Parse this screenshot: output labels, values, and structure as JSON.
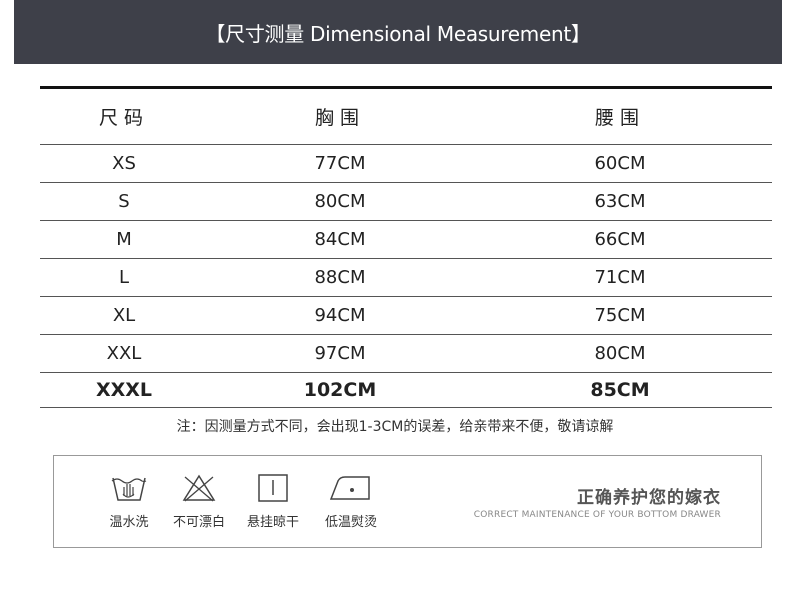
{
  "header": {
    "title": "【尺寸测量 Dimensional Measurement】"
  },
  "table": {
    "columns": [
      "尺码",
      "胸围",
      "腰围"
    ],
    "rows": [
      [
        "XS",
        "77CM",
        "60CM"
      ],
      [
        "S",
        "80CM",
        "63CM"
      ],
      [
        "M",
        "84CM",
        "66CM"
      ],
      [
        "L",
        "88CM",
        "71CM"
      ],
      [
        "XL",
        "94CM",
        "75CM"
      ],
      [
        "XXL",
        "97CM",
        "80CM"
      ],
      [
        "XXXL",
        "102CM",
        "85CM"
      ]
    ]
  },
  "note": "注：因测量方式不同，会出现1-3CM的误差，给亲带来不便，敬请谅解",
  "care": {
    "items": [
      {
        "icon": "warm-water-wash-icon",
        "label": "温水洗"
      },
      {
        "icon": "no-bleach-icon",
        "label": "不可漂白"
      },
      {
        "icon": "hang-dry-icon",
        "label": "悬挂晾干"
      },
      {
        "icon": "low-temp-iron-icon",
        "label": "低温熨烫"
      }
    ],
    "title": "正确养护您的嫁衣",
    "subtitle": "CORRECT MAINTENANCE OF YOUR BOTTOM DRAWER"
  }
}
